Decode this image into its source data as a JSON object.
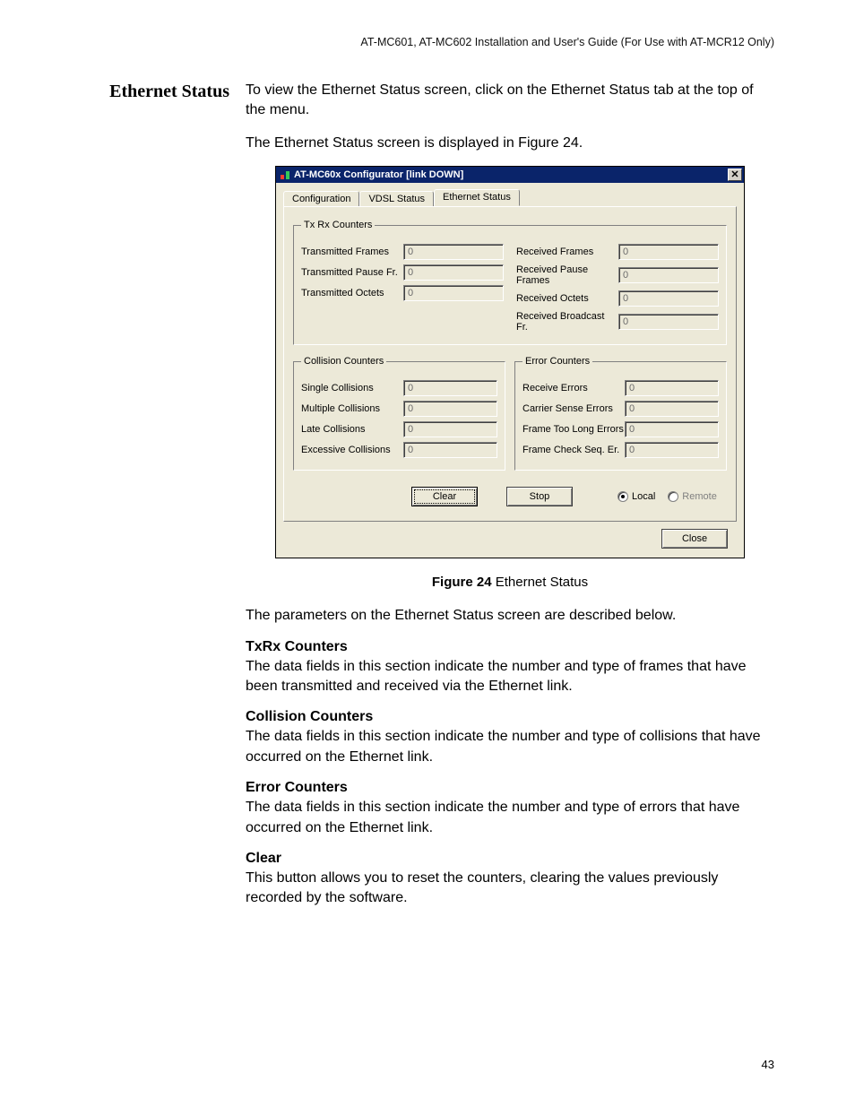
{
  "doc_header": "AT-MC601, AT-MC602 Installation and User's Guide (For Use with AT-MCR12 Only)",
  "side_heading": "Ethernet Status",
  "paras": {
    "p1": "To view the Ethernet Status screen, click on the Ethernet Status tab at the top of the menu.",
    "p2": "The Ethernet Status screen is displayed in Figure 24.",
    "fig_label_bold": "Figure 24",
    "fig_label_rest": "  Ethernet Status",
    "p3": "The parameters on the Ethernet Status screen are described below.",
    "h_txrx": "TxRx Counters",
    "p_txrx": "The data fields in this section indicate the number and type of frames that have been transmitted and received via the Ethernet link.",
    "h_coll": "Collision Counters",
    "p_coll": "The data fields in this section indicate the number and type of collisions that have occurred on the Ethernet link.",
    "h_err": "Error Counters",
    "p_err": "The data fields in this section indicate the number and type of errors that have occurred on the Ethernet link.",
    "h_clear": "Clear",
    "p_clear": "This button allows you to reset the counters, clearing the values previously recorded by the software."
  },
  "window": {
    "title": "AT-MC60x Configurator  [link DOWN]",
    "tabs": {
      "t1": "Configuration",
      "t2": "VDSL Status",
      "t3": "Ethernet Status"
    },
    "groups": {
      "txrx": "Tx Rx Counters",
      "coll": "Collision Counters",
      "err": "Error Counters"
    },
    "fields": {
      "tx_frames": {
        "label": "Transmitted Frames",
        "value": "0"
      },
      "tx_pause": {
        "label": "Transmitted Pause Fr.",
        "value": "0"
      },
      "tx_octets": {
        "label": "Transmitted Octets",
        "value": "0"
      },
      "rx_frames": {
        "label": "Received Frames",
        "value": "0"
      },
      "rx_pause": {
        "label": "Received Pause Frames",
        "value": "0"
      },
      "rx_octets": {
        "label": "Received Octets",
        "value": "0"
      },
      "rx_bcast": {
        "label": "Received Broadcast Fr.",
        "value": "0"
      },
      "single_coll": {
        "label": "Single Collisions",
        "value": "0"
      },
      "mult_coll": {
        "label": "Multiple Collisions",
        "value": "0"
      },
      "late_coll": {
        "label": "Late Collisions",
        "value": "0"
      },
      "exc_coll": {
        "label": "Excessive Collisions",
        "value": "0"
      },
      "rx_err": {
        "label": "Receive Errors",
        "value": "0"
      },
      "carrier": {
        "label": "Carrier Sense Errors",
        "value": "0"
      },
      "toolong": {
        "label": "Frame Too Long Errors",
        "value": "0"
      },
      "fcs": {
        "label": "Frame Check Seq. Er.",
        "value": "0"
      }
    },
    "buttons": {
      "clear": "Clear",
      "stop": "Stop",
      "close": "Close"
    },
    "radios": {
      "local": "Local",
      "remote": "Remote"
    }
  },
  "page_number": "43"
}
